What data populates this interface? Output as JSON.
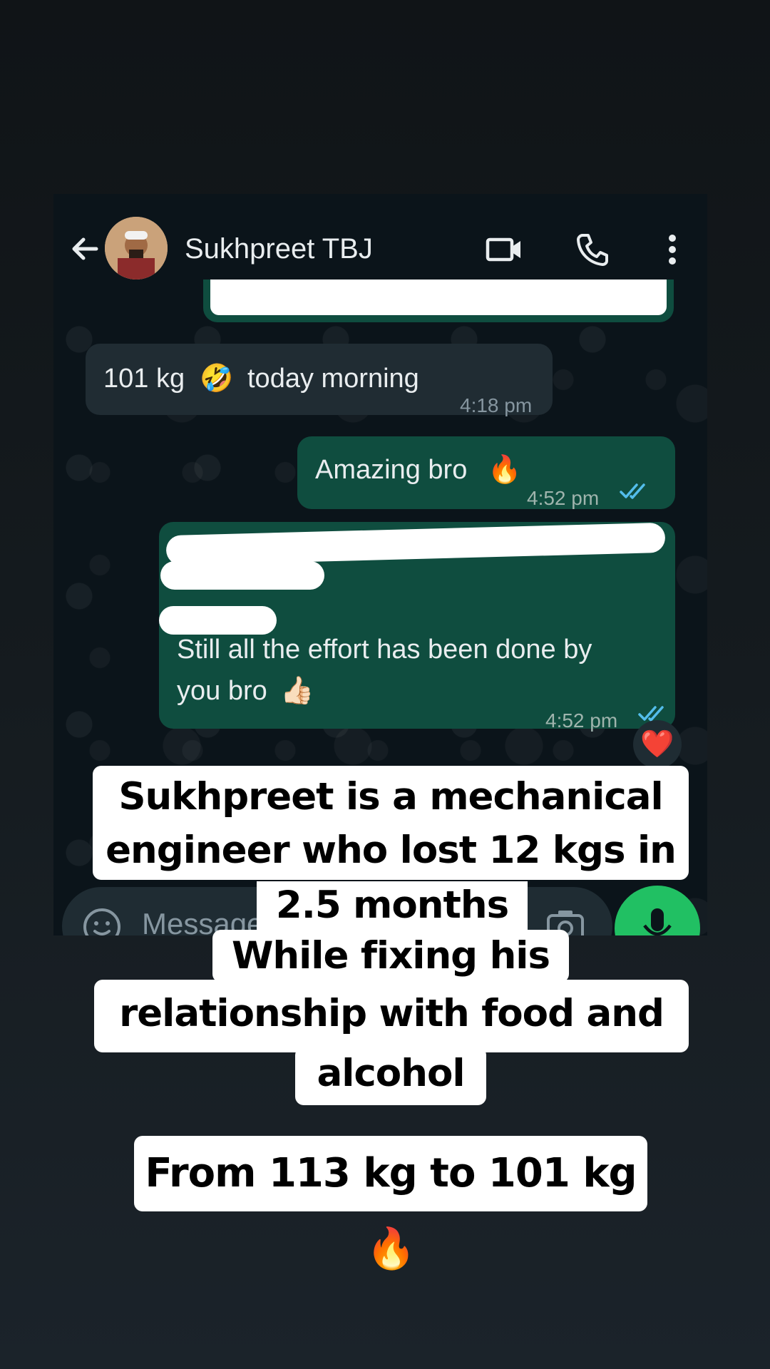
{
  "chat_header": {
    "contact_name": "Sukhpreet TBJ"
  },
  "messages": [
    {
      "id": "m1",
      "direction": "incoming",
      "text": "101 kg",
      "emoji": "🤣",
      "text_after": "today morning",
      "time": "4:18 pm"
    },
    {
      "id": "m2",
      "direction": "outgoing",
      "text": "Amazing bro",
      "emoji": "🔥",
      "time": "4:52 pm",
      "status": "read"
    },
    {
      "id": "m3",
      "direction": "outgoing",
      "text_line1": "Still all the effort has been done by",
      "text_line2": "you bro",
      "emoji": "👍🏻",
      "time": "4:52 pm",
      "status": "read",
      "reaction": "❤️"
    }
  ],
  "input": {
    "placeholder": "Message"
  },
  "overlay_text": {
    "line1": "Sukhpreet is a mechanical",
    "line2": "engineer who lost 12 kgs in",
    "line3": "2.5 months",
    "line4": "While fixing his",
    "line5": "relationship with food and",
    "line6": "alcohol",
    "line7": "From 113 kg to 101 kg🔥"
  },
  "colors": {
    "outgoing_bubble": "#0f4d3f",
    "incoming_bubble": "#202c33",
    "read_ticks": "#53bdeb",
    "mic_button": "#21c063"
  }
}
